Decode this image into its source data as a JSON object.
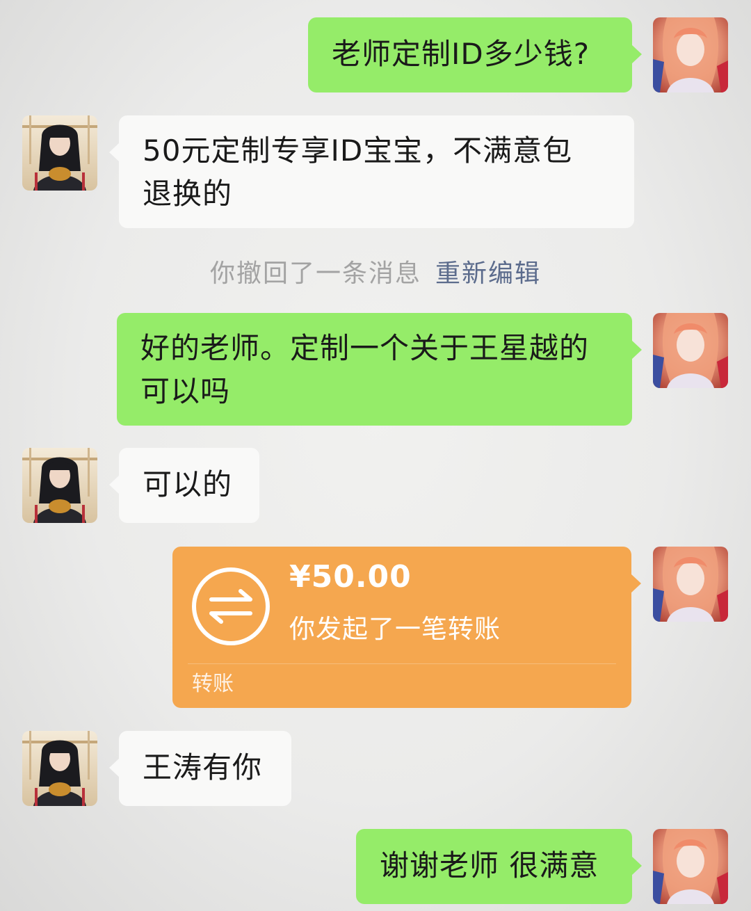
{
  "messages": [
    {
      "side": "right",
      "type": "text",
      "text": "老师定制ID多少钱?"
    },
    {
      "side": "left",
      "type": "text",
      "lines": [
        "50元定制专享ID宝宝，不满意包",
        "退换的"
      ]
    },
    {
      "type": "system",
      "text": "你撤回了一条消息",
      "action": "重新编辑"
    },
    {
      "side": "right",
      "type": "text",
      "lines": [
        "好的老师。定制一个关于王星越的",
        "可以吗"
      ]
    },
    {
      "side": "left",
      "type": "text",
      "text": "可以的"
    },
    {
      "side": "right",
      "type": "transfer",
      "amount": "¥50.00",
      "desc": "你发起了一笔转账",
      "label": "转账",
      "icon": "transfer-arrows-icon"
    },
    {
      "side": "left",
      "type": "text",
      "text": "王涛有你"
    },
    {
      "side": "right",
      "type": "text",
      "text": "谢谢老师 很满意"
    }
  ],
  "avatars": {
    "self": "avatar-orange-hair",
    "other": "avatar-dark-hair"
  },
  "colors": {
    "green_bubble": "#95ec69",
    "white_bubble": "#f9f9f8",
    "transfer": "#f5a74f",
    "link": "#5b6b8c",
    "system_text": "#a3a3a3"
  }
}
